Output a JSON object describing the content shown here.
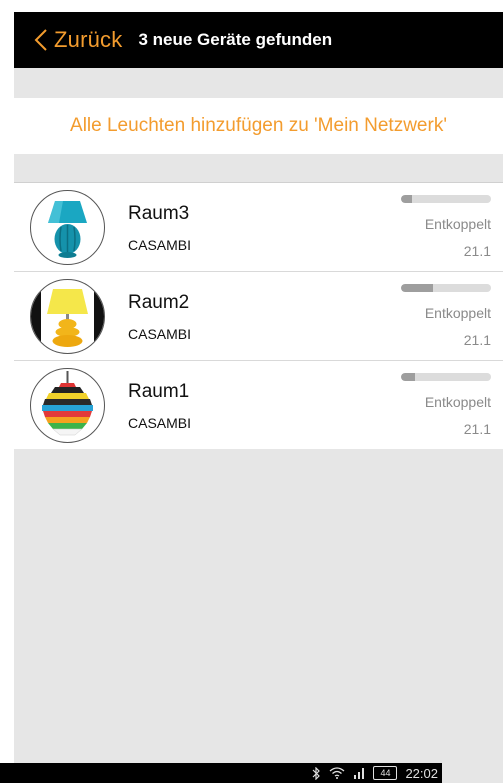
{
  "header": {
    "back_label": "Zurück",
    "title": "3 neue Geräte gefunden"
  },
  "add_all_label": "Alle Leuchten hinzufügen zu 'Mein Netzwerk'",
  "devices": [
    {
      "name": "Raum3",
      "brand": "CASAMBI",
      "status": "Entkoppelt",
      "version": "21.1",
      "signal_fraction": 0.12,
      "image": "blue-table-lamp"
    },
    {
      "name": "Raum2",
      "brand": "CASAMBI",
      "status": "Entkoppelt",
      "version": "21.1",
      "signal_fraction": 0.35,
      "image": "yellow-table-lamp"
    },
    {
      "name": "Raum1",
      "brand": "CASAMBI",
      "status": "Entkoppelt",
      "version": "21.1",
      "signal_fraction": 0.15,
      "image": "striped-pendant-lamp"
    }
  ],
  "statusbar": {
    "battery": "44",
    "time": "22:02",
    "icons": [
      "bluetooth-icon",
      "wifi-icon",
      "signal-icon",
      "battery-icon"
    ]
  },
  "colors": {
    "accent": "#f39c2e",
    "header_bg": "#000000",
    "background": "#e6e6e6"
  }
}
